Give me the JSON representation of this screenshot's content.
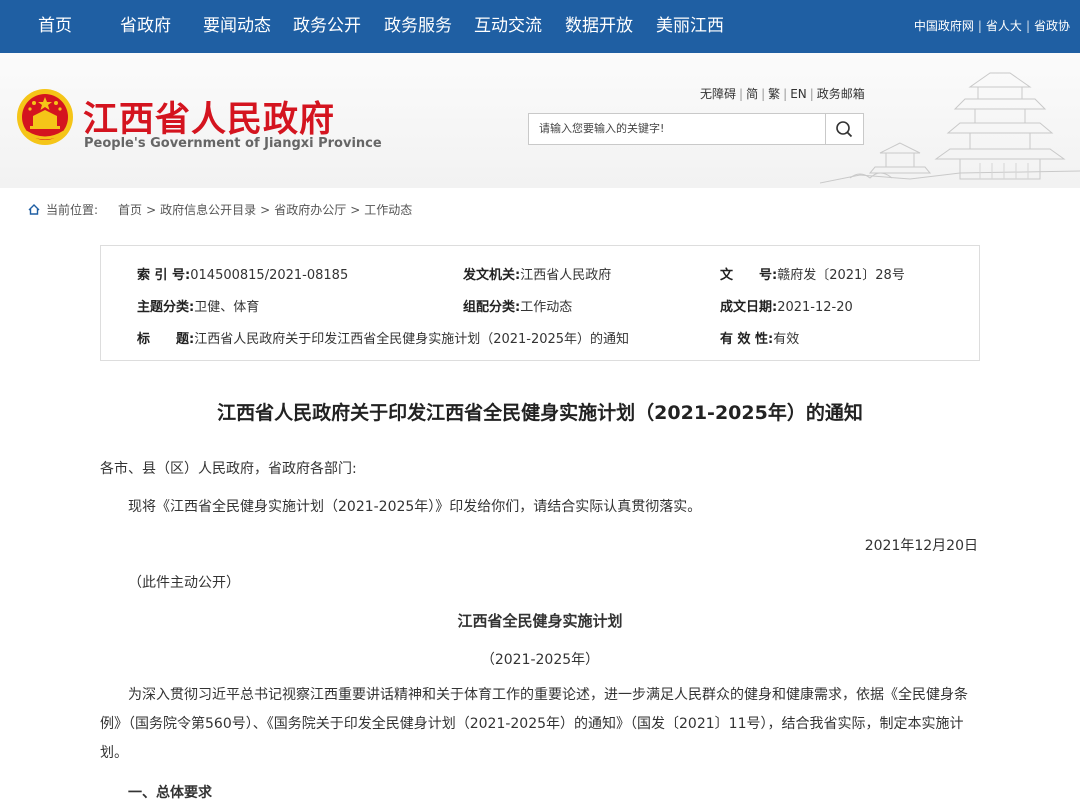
{
  "top_nav": {
    "items": [
      "首页",
      "省政府",
      "要闻动态",
      "政务公开",
      "政务服务",
      "互动交流",
      "数据开放",
      "美丽江西"
    ],
    "links": [
      "中国政府网",
      "省人大",
      "省政协"
    ]
  },
  "header": {
    "title": "江西省人民政府",
    "subtitle": "People's Government of Jiangxi Province",
    "util_links": [
      "无障碍",
      "简",
      "繁",
      "EN",
      "政务邮箱"
    ],
    "search_placeholder": "请输入您要输入的关键字!"
  },
  "breadcrumb": {
    "label": "当前位置:",
    "items": [
      "首页",
      "政府信息公开目录",
      "省政府办公厅",
      "工作动态"
    ]
  },
  "meta": {
    "index_label": "索 引 号:",
    "index_value": "014500815/2021-08185",
    "issuer_label": "发文机关:",
    "issuer_value": "江西省人民政府",
    "docno_label": "文　　号:",
    "docno_value": "赣府发〔2021〕28号",
    "topic_label": "主题分类:",
    "topic_value": "卫健、体育",
    "category_label": "组配分类:",
    "category_value": "工作动态",
    "date_label": "成文日期:",
    "date_value": "2021-12-20",
    "title_label": "标　　题:",
    "title_value": "江西省人民政府关于印发江西省全民健身实施计划（2021-2025年）的通知",
    "valid_label": "有 效 性:",
    "valid_value": "有效"
  },
  "article": {
    "title": "江西省人民政府关于印发江西省全民健身实施计划（2021-2025年）的通知",
    "salutation": "各市、县（区）人民政府，省政府各部门:",
    "intro": "现将《江西省全民健身实施计划（2021-2025年）》印发给你们，请结合实际认真贯彻落实。",
    "date": "2021年12月20日",
    "public_note": "（此件主动公开）",
    "plan_title": "江西省全民健身实施计划",
    "plan_years": "（2021-2025年）",
    "paragraph1": "为深入贯彻习近平总书记视察江西重要讲话精神和关于体育工作的重要论述，进一步满足人民群众的健身和健康需求，依据《全民健身条例》（国务院令第560号）、《国务院关于印发全民健身计划（2021-2025年）的通知》（国发〔2021〕11号），结合我省实际，制定本实施计划。",
    "section1": "一、总体要求"
  },
  "colors": {
    "nav_blue": "#1f5fa3",
    "title_red": "#d4141f",
    "emblem_gold": "#f5c518"
  }
}
